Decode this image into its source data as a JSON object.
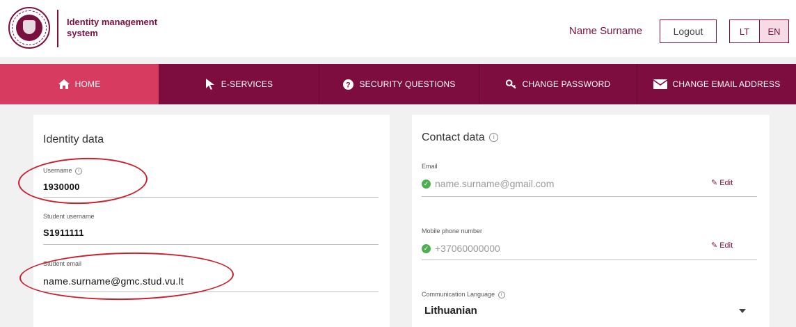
{
  "header": {
    "app_title": "Identity management system",
    "user_name": "Name Surname",
    "logout_label": "Logout",
    "languages": [
      {
        "code": "LT",
        "active": false
      },
      {
        "code": "EN",
        "active": true
      }
    ]
  },
  "nav": {
    "items": [
      {
        "label": "HOME",
        "icon": "home-icon",
        "active": true
      },
      {
        "label": "E-SERVICES",
        "icon": "cursor-icon",
        "active": false
      },
      {
        "label": "SECURITY QUESTIONS",
        "icon": "question-icon",
        "active": false
      },
      {
        "label": "CHANGE PASSWORD",
        "icon": "key-icon",
        "active": false
      },
      {
        "label": "CHANGE EMAIL ADDRESS",
        "icon": "envelope-icon",
        "active": false
      }
    ]
  },
  "identity": {
    "title": "Identity data",
    "username_label": "Username",
    "username_value": "1930000",
    "student_username_label": "Student username",
    "student_username_value": "S1911111",
    "student_email_label": "Student email",
    "student_email_value": "name.surname@gmc.stud.vu.lt"
  },
  "contact": {
    "title": "Contact data",
    "email_label": "Email",
    "email_value": "name.surname@gmail.com",
    "email_edit": "Edit",
    "phone_label": "Mobile phone number",
    "phone_value": "+37060000000",
    "phone_edit": "Edit",
    "language_label": "Communication Language",
    "language_value": "Lithuanian"
  },
  "colors": {
    "brand": "#7d0d3e",
    "nav_active": "#d73b5f",
    "verified": "#4caf50",
    "annotation": "#cc1f2d"
  }
}
